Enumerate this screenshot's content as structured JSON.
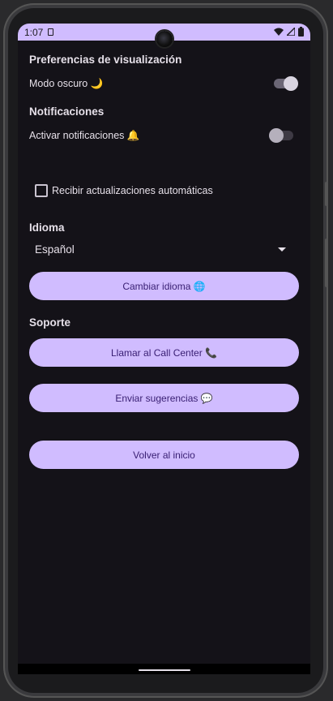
{
  "status_bar": {
    "time": "1:07",
    "icons": [
      "sim-card-icon",
      "wifi-icon",
      "signal-icon",
      "battery-icon"
    ]
  },
  "display": {
    "title": "Preferencias de visualización",
    "dark_mode_label": "Modo oscuro 🌙",
    "dark_mode_on": true
  },
  "notifications": {
    "title": "Notificaciones",
    "enable_label": "Activar notificaciones 🔔",
    "enable_on": false,
    "auto_updates_label": "Recibir actualizaciones automáticas",
    "auto_updates_checked": false
  },
  "language": {
    "title": "Idioma",
    "selected": "Español",
    "change_button": "Cambiar idioma 🌐"
  },
  "support": {
    "title": "Soporte",
    "call_button": "Llamar al Call Center 📞",
    "suggest_button": "Enviar sugerencias 💬"
  },
  "home_button": "Volver al inicio",
  "colors": {
    "accent": "#d0bcff",
    "background": "#141218",
    "on_accent": "#381e72",
    "text": "#e6e0e9"
  }
}
